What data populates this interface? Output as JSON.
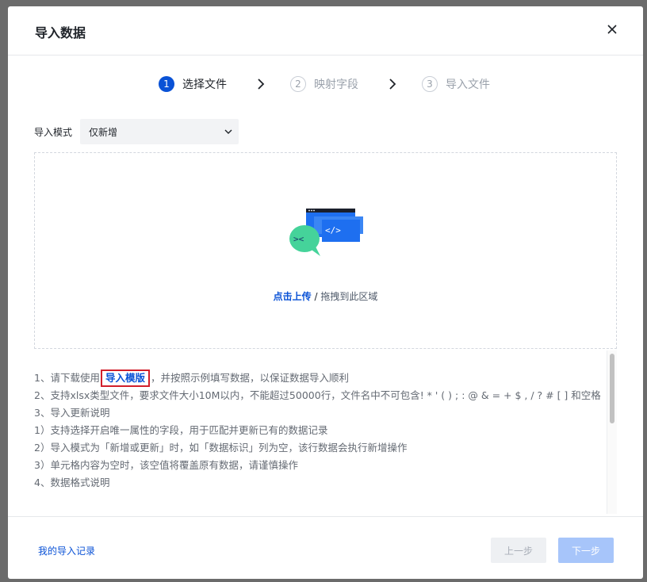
{
  "dialog": {
    "title": "导入数据",
    "close_icon": "close-icon"
  },
  "steps": [
    {
      "number": "1",
      "label": "选择文件",
      "state": "active"
    },
    {
      "number": "2",
      "label": "映射字段",
      "state": "idle"
    },
    {
      "number": "3",
      "label": "导入文件",
      "state": "idle"
    }
  ],
  "import_mode": {
    "label": "导入模式",
    "value": "仅新增"
  },
  "upload": {
    "click_label": "点击上传",
    "separator": " / ",
    "drag_label": "拖拽到此区域",
    "illustration_icon": "code-chat-illustration-icon"
  },
  "instructions": {
    "line1_prefix": "1、请下载使用",
    "template_link": "导入模版",
    "line1_suffix": "，并按照示例填写数据，以保证数据导入顺利",
    "line2": "2、支持xlsx类型文件，要求文件大小10M以内，不能超过50000行，文件名中不可包含! * ' ( ) ; : @ & = + $ , / ? # [ ] 和空格",
    "line3": "3、导入更新说明",
    "line3_1": " 1）支持选择开启唯一属性的字段，用于匹配并更新已有的数据记录",
    "line3_2": " 2）导入模式为「新增或更新」时，如「数据标识」列为空，该行数据会执行新增操作",
    "line3_3": " 3）单元格内容为空时，该空值将覆盖原有数据，请谨慎操作",
    "line4": "4、数据格式说明"
  },
  "footer": {
    "my_records": "我的导入记录",
    "prev_button": "上一步",
    "next_button": "下一步"
  },
  "colors": {
    "accent": "#0a52d6",
    "highlight_border": "#d21f2b",
    "disabled_next": "#a7c5fa"
  }
}
